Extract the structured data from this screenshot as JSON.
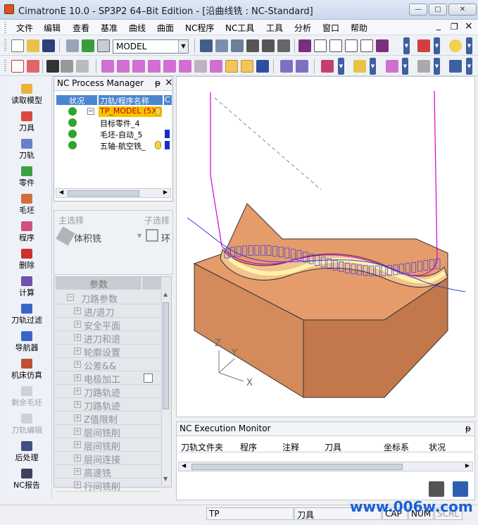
{
  "window": {
    "title": "CimatronE 10.0 - SP3P2 64–Bit Edition - [沿曲线铣 : NC-Standard]",
    "min": "—",
    "max": "▢",
    "close": "✕"
  },
  "menu": [
    "文件",
    "编辑",
    "查看",
    "基准",
    "曲线",
    "曲面",
    "NC程序",
    "NC工具",
    "工具",
    "分析",
    "窗口",
    "帮助"
  ],
  "mdi": {
    "min": "_",
    "restore": "❐",
    "close": "×"
  },
  "toolbar": {
    "model_combo": "MODEL"
  },
  "leftbar": [
    {
      "label": "读取模型",
      "icon": "read-model-icon",
      "disabled": false
    },
    {
      "label": "刀具",
      "icon": "tool-icon",
      "disabled": false
    },
    {
      "label": "刀轨",
      "icon": "toolpath-icon",
      "disabled": false
    },
    {
      "label": "零件",
      "icon": "part-icon",
      "disabled": false
    },
    {
      "label": "毛坯",
      "icon": "stock-icon",
      "disabled": false
    },
    {
      "label": "程序",
      "icon": "procedure-icon",
      "disabled": false
    },
    {
      "label": "删除",
      "icon": "delete-icon",
      "disabled": false
    },
    {
      "label": "计算",
      "icon": "compute-icon",
      "disabled": false
    },
    {
      "label": "刀轨过滤",
      "icon": "toolpath-filter-icon",
      "disabled": false
    },
    {
      "label": "导航器",
      "icon": "navigator-icon",
      "disabled": false
    },
    {
      "label": "机床仿真",
      "icon": "machine-sim-icon",
      "disabled": false
    },
    {
      "label": "剩余毛坯",
      "icon": "remaining-stock-icon",
      "disabled": true
    },
    {
      "label": "刀轨编辑",
      "icon": "toolpath-edit-icon",
      "disabled": true
    },
    {
      "label": "后处理",
      "icon": "post-process-icon",
      "disabled": false
    },
    {
      "label": "NC报告",
      "icon": "nc-report-icon",
      "disabled": false
    }
  ],
  "process_manager": {
    "title": "NC Process Manager",
    "pin": "ᵽ",
    "close": "×",
    "columns": [
      "状况",
      "刀轨/程序名称",
      "C"
    ],
    "rows": [
      {
        "name": "TP_MODEL (5X",
        "selected": true,
        "toggle": "−"
      },
      {
        "name": "目标零件_4",
        "selected": false,
        "toggle": ""
      },
      {
        "name": "毛坯-自动_5",
        "selected": false,
        "toggle": ""
      },
      {
        "name": "五轴-航空铣_",
        "selected": false,
        "toggle": ""
      }
    ]
  },
  "selection": {
    "main_label": "主选择",
    "sub_label": "子选择",
    "main_value": "体积铣",
    "sub_value": "环"
  },
  "params": {
    "header": "参数",
    "rows": [
      "刀路参数",
      "进/退刀",
      "安全平面",
      "进刀和退",
      "轮廓设置",
      "公差&&",
      "电极加工",
      "刀路轨迹",
      "刀路轨迹",
      "Z值限制",
      "层间铣削",
      "层间铣削",
      "层间连接",
      "高速铣",
      "行间铣削"
    ]
  },
  "exec_monitor": {
    "title": "NC Execution Monitor",
    "pin": "ᵽ",
    "columns": [
      "刀轨文件夹",
      "程序",
      "注释",
      "刀具",
      "坐标系",
      "状况"
    ]
  },
  "status": {
    "tp": "TP",
    "tool": "刀具",
    "cap": "CAP",
    "num": "NUM",
    "scrl": "SCRL",
    "watermark": "www.006w.com"
  },
  "viewport": {
    "axis_x": "X",
    "axis_y": "Y",
    "axis_z": "Z"
  },
  "colors": {
    "selected_row": "#f5c400",
    "header_blue": "#4a86d0",
    "toolpath": "#d300d3",
    "block": "#d89060"
  }
}
